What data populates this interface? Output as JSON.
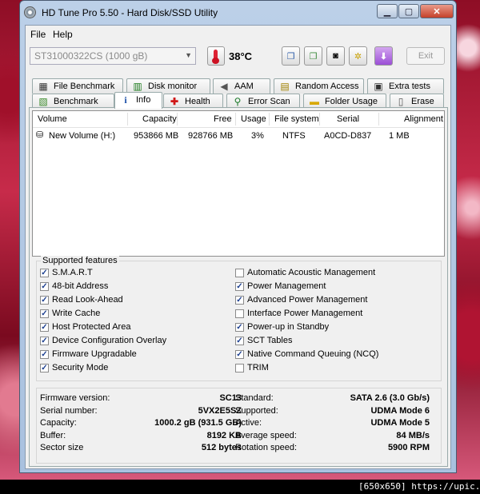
{
  "window": {
    "title": "HD Tune Pro 5.50 - Hard Disk/SSD Utility"
  },
  "menu": {
    "file": "File",
    "help": "Help"
  },
  "toolbar": {
    "drive": "ST31000322CS (1000 gB)",
    "temperature": "38°C",
    "exit": "Exit"
  },
  "tabs_top": [
    "File Benchmark",
    "Disk monitor",
    "AAM",
    "Random Access",
    "Extra tests"
  ],
  "tabs_bottom": [
    "Benchmark",
    "Info",
    "Health",
    "Error Scan",
    "Folder Usage",
    "Erase"
  ],
  "volume_table": {
    "columns": [
      "Volume",
      "Capacity",
      "Free",
      "Usage",
      "File system",
      "Serial",
      "Alignment"
    ],
    "rows": [
      {
        "volume": "New Volume (H:)",
        "capacity": "953866 MB",
        "free": "928766 MB",
        "usage": "3%",
        "file_system": "NTFS",
        "serial": "A0CD-D837",
        "alignment": "1 MB"
      }
    ]
  },
  "features": {
    "legend": "Supported features",
    "left": [
      {
        "label": "S.M.A.R.T",
        "checked": true
      },
      {
        "label": "48-bit Address",
        "checked": true
      },
      {
        "label": "Read Look-Ahead",
        "checked": true
      },
      {
        "label": "Write Cache",
        "checked": true
      },
      {
        "label": "Host Protected Area",
        "checked": true
      },
      {
        "label": "Device Configuration Overlay",
        "checked": true
      },
      {
        "label": "Firmware Upgradable",
        "checked": true
      },
      {
        "label": "Security Mode",
        "checked": true
      }
    ],
    "right": [
      {
        "label": "Automatic Acoustic Management",
        "checked": false
      },
      {
        "label": "Power Management",
        "checked": true
      },
      {
        "label": "Advanced Power Management",
        "checked": true
      },
      {
        "label": "Interface Power Management",
        "checked": false
      },
      {
        "label": "Power-up in Standby",
        "checked": true
      },
      {
        "label": "SCT Tables",
        "checked": true
      },
      {
        "label": "Native Command Queuing (NCQ)",
        "checked": true
      },
      {
        "label": "TRIM",
        "checked": false
      }
    ]
  },
  "info": {
    "left": [
      {
        "label": "Firmware version:",
        "value": "SC13"
      },
      {
        "label": "Serial number:",
        "value": "5VX2E5SZ"
      },
      {
        "label": "Capacity:",
        "value": "1000.2 gB (931.5 GB)"
      },
      {
        "label": "Buffer:",
        "value": "8192 KB"
      },
      {
        "label": "Sector size",
        "value": "512 bytes"
      }
    ],
    "right": [
      {
        "label": "Standard:",
        "value": "SATA 2.6 (3.0 Gb/s)"
      },
      {
        "label": "Supported:",
        "value": "UDMA Mode 6"
      },
      {
        "label": "Active:",
        "value": "UDMA Mode 5"
      },
      {
        "label": "Average speed:",
        "value": "84 MB/s"
      },
      {
        "label": "Rotation speed:",
        "value": "5900 RPM"
      }
    ]
  },
  "watermark": "[650x650] https://upic.me/"
}
